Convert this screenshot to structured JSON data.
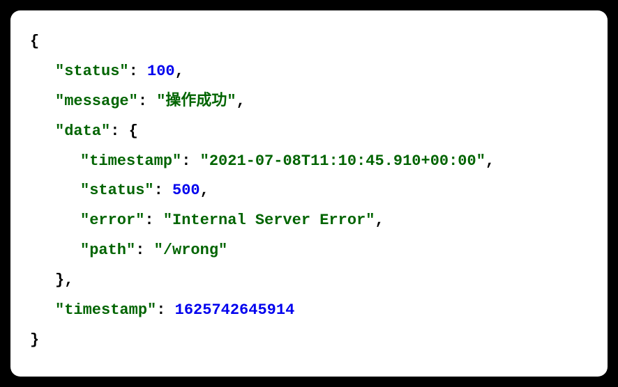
{
  "json_display": {
    "open_brace": "{",
    "status_key": "\"status\"",
    "status_value": "100",
    "message_key": "\"message\"",
    "message_value": "\"操作成功\"",
    "data_key": "\"data\"",
    "data_open": "{",
    "timestamp_key": "\"timestamp\"",
    "timestamp_value": "\"2021-07-08T11:10:45.910+00:00\"",
    "inner_status_key": "\"status\"",
    "inner_status_value": "500",
    "error_key": "\"error\"",
    "error_value": "\"Internal Server Error\"",
    "path_key": "\"path\"",
    "path_value": "\"/wrong\"",
    "data_close": "}",
    "outer_timestamp_key": "\"timestamp\"",
    "outer_timestamp_value": "1625742645914",
    "close_brace": "}",
    "colon_space": ": ",
    "comma": ","
  }
}
